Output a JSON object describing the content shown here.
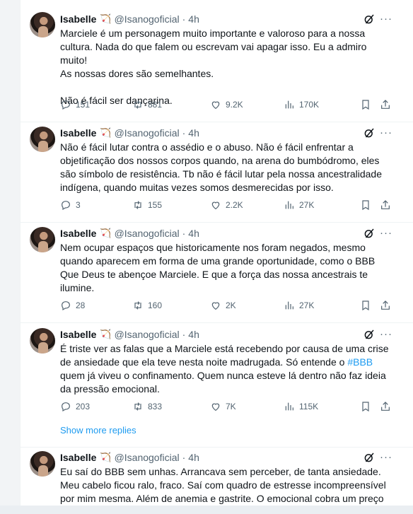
{
  "author": {
    "name": "Isabelle",
    "handle": "@Isanogoficial",
    "emoji": "🏹"
  },
  "tweets": [
    {
      "time": "4h",
      "text": "Marciele é um personagem muito importante e valoroso para a nossa\ncultura. Nada do que falem ou escrevam vai apagar isso. Eu a admiro muito!\nAs nossas dores são semelhantes.\n\nNão é fácil ser dançarina.",
      "replies": "151",
      "reposts": "881",
      "likes": "9.2K",
      "views": "170K"
    },
    {
      "time": "4h",
      "text": "Não é fácil lutar contra o assédio e o abuso. Não é fácil enfrentar a\nobjetificação dos nossos corpos quando, na arena do bumbódromo, eles\nsão símbolo de resistência. Tb não é fácil lutar pela nossa ancestralidade\nindígena, quando muitas vezes somos desmerecidas por isso.",
      "replies": "3",
      "reposts": "155",
      "likes": "2.2K",
      "views": "27K"
    },
    {
      "time": "4h",
      "text": "Nem ocupar espaços que historicamente nos foram negados, mesmo\nquando aparecem em forma de uma grande oportunidade, como o BBB\nQue Deus te abençoe Marciele. E que a força das nossa ancestrais te\nilumine.",
      "replies": "28",
      "reposts": "160",
      "likes": "2K",
      "views": "27K"
    },
    {
      "time": "4h",
      "text_before": "É triste ver as falas que a Marciele está recebendo por causa de uma crise\nde ansiedade que ela teve nesta noite madrugada. Só entende o ",
      "hashtag": "#BBB",
      "text_after": "\nquem já viveu o confinamento. Quem nunca esteve lá dentro não faz ideia\nda pressão emocional.",
      "replies": "203",
      "reposts": "833",
      "likes": "7K",
      "views": "115K"
    },
    {
      "time": "4h",
      "text": "Eu saí do BBB sem unhas. Arrancava sem perceber, de tanta ansiedade.\nMeu cabelo ficou ralo, fraco. Saí com quadro de estresse incompreensível\npor mim mesma. Além de anemia e gastrite. O emocional cobra um preço"
    }
  ],
  "show_more_replies": "Show more replies",
  "ui": {
    "dot": "·",
    "more": "···"
  },
  "colors": {
    "accent": "#1d9bf0",
    "text": "#0f1419",
    "muted": "#536471"
  }
}
